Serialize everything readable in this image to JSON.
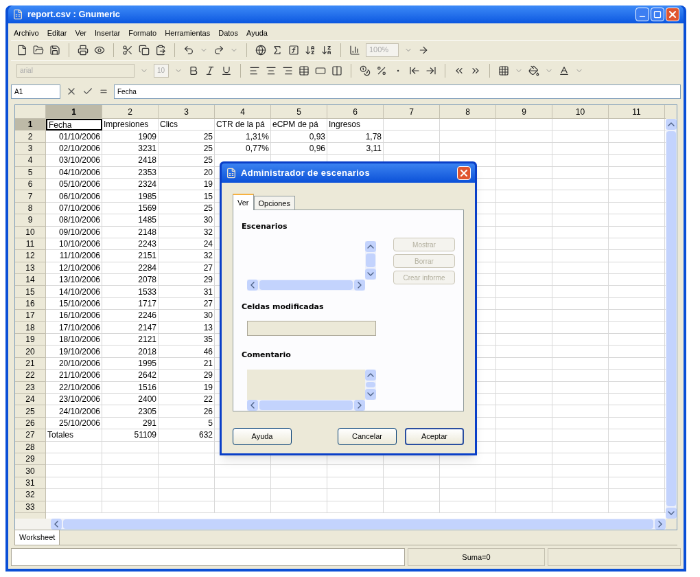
{
  "window": {
    "title": "report.csv : Gnumeric"
  },
  "menu": [
    {
      "label": "Archivo"
    },
    {
      "label": "Editar"
    },
    {
      "label": "Ver"
    },
    {
      "label": "Insertar"
    },
    {
      "label": "Formato"
    },
    {
      "label": "Herramientas"
    },
    {
      "label": "Datos"
    },
    {
      "label": "Ayuda"
    }
  ],
  "toolbar_standard": {
    "zoom": "100%"
  },
  "toolbar_format": {
    "font": "arial",
    "size": "10"
  },
  "formula_bar": {
    "cell": "A1",
    "value": "Fecha"
  },
  "sheet": {
    "columns": [
      {
        "label": "1",
        "selected": true
      },
      {
        "label": "2",
        "selected": false
      },
      {
        "label": "3",
        "selected": false
      },
      {
        "label": "4",
        "selected": false
      },
      {
        "label": "5",
        "selected": false
      },
      {
        "label": "6",
        "selected": false
      },
      {
        "label": "7",
        "selected": false
      },
      {
        "label": "8",
        "selected": false
      },
      {
        "label": "9",
        "selected": false
      },
      {
        "label": "10",
        "selected": false
      },
      {
        "label": "11",
        "selected": false
      }
    ],
    "rows": [
      {
        "label": "1",
        "selected": true,
        "kind": "header",
        "cells": [
          "Fecha",
          "Impresiones",
          "Clics",
          "CTR de la pá",
          "eCPM de pá",
          "Ingresos"
        ]
      },
      {
        "label": "2",
        "selected": false,
        "kind": "data",
        "cells": [
          "01/10/2006",
          "1909",
          "25",
          "1,31%",
          "0,93",
          "1,78"
        ]
      },
      {
        "label": "3",
        "selected": false,
        "kind": "data",
        "cells": [
          "02/10/2006",
          "3231",
          "25",
          "0,77%",
          "0,96",
          "3,11"
        ]
      },
      {
        "label": "4",
        "selected": false,
        "kind": "data",
        "cells": [
          "03/10/2006",
          "2418",
          "25"
        ]
      },
      {
        "label": "5",
        "selected": false,
        "kind": "data",
        "cells": [
          "04/10/2006",
          "2353",
          "20"
        ]
      },
      {
        "label": "6",
        "selected": false,
        "kind": "data",
        "cells": [
          "05/10/2006",
          "2324",
          "19"
        ]
      },
      {
        "label": "7",
        "selected": false,
        "kind": "data",
        "cells": [
          "06/10/2006",
          "1985",
          "15"
        ]
      },
      {
        "label": "8",
        "selected": false,
        "kind": "data",
        "cells": [
          "07/10/2006",
          "1569",
          "25"
        ]
      },
      {
        "label": "9",
        "selected": false,
        "kind": "data",
        "cells": [
          "08/10/2006",
          "1485",
          "30"
        ]
      },
      {
        "label": "10",
        "selected": false,
        "kind": "data",
        "cells": [
          "09/10/2006",
          "2148",
          "32"
        ]
      },
      {
        "label": "11",
        "selected": false,
        "kind": "data",
        "cells": [
          "10/10/2006",
          "2243",
          "24"
        ]
      },
      {
        "label": "12",
        "selected": false,
        "kind": "data",
        "cells": [
          "11/10/2006",
          "2151",
          "32"
        ]
      },
      {
        "label": "13",
        "selected": false,
        "kind": "data",
        "cells": [
          "12/10/2006",
          "2284",
          "27"
        ]
      },
      {
        "label": "14",
        "selected": false,
        "kind": "data",
        "cells": [
          "13/10/2006",
          "2078",
          "29"
        ]
      },
      {
        "label": "15",
        "selected": false,
        "kind": "data",
        "cells": [
          "14/10/2006",
          "1533",
          "31"
        ]
      },
      {
        "label": "16",
        "selected": false,
        "kind": "data",
        "cells": [
          "15/10/2006",
          "1717",
          "27"
        ]
      },
      {
        "label": "17",
        "selected": false,
        "kind": "data",
        "cells": [
          "16/10/2006",
          "2246",
          "30"
        ]
      },
      {
        "label": "18",
        "selected": false,
        "kind": "data",
        "cells": [
          "17/10/2006",
          "2147",
          "13"
        ]
      },
      {
        "label": "19",
        "selected": false,
        "kind": "data",
        "cells": [
          "18/10/2006",
          "2121",
          "35"
        ]
      },
      {
        "label": "20",
        "selected": false,
        "kind": "data",
        "cells": [
          "19/10/2006",
          "2018",
          "46"
        ]
      },
      {
        "label": "21",
        "selected": false,
        "kind": "data",
        "cells": [
          "20/10/2006",
          "1995",
          "21"
        ]
      },
      {
        "label": "22",
        "selected": false,
        "kind": "data",
        "cells": [
          "21/10/2006",
          "2642",
          "29"
        ]
      },
      {
        "label": "23",
        "selected": false,
        "kind": "data",
        "cells": [
          "22/10/2006",
          "1516",
          "19"
        ]
      },
      {
        "label": "24",
        "selected": false,
        "kind": "data",
        "cells": [
          "23/10/2006",
          "2400",
          "22"
        ]
      },
      {
        "label": "25",
        "selected": false,
        "kind": "data",
        "cells": [
          "24/10/2006",
          "2305",
          "26"
        ]
      },
      {
        "label": "26",
        "selected": false,
        "kind": "data",
        "cells": [
          "25/10/2006",
          "291",
          "5"
        ]
      },
      {
        "label": "27",
        "selected": false,
        "kind": "total",
        "cells": [
          "Totales",
          "51109",
          "632"
        ]
      },
      {
        "label": "28",
        "selected": false,
        "kind": "empty"
      },
      {
        "label": "29",
        "selected": false,
        "kind": "empty"
      },
      {
        "label": "30",
        "selected": false,
        "kind": "empty"
      },
      {
        "label": "31",
        "selected": false,
        "kind": "empty"
      },
      {
        "label": "32",
        "selected": false,
        "kind": "empty"
      },
      {
        "label": "33",
        "selected": false,
        "kind": "empty"
      }
    ]
  },
  "sheet_tabs": [
    {
      "label": "Worksheet",
      "selected": true
    }
  ],
  "status_bar": {
    "sum": "Suma=0"
  },
  "dialog": {
    "title": "Administrador de escenarios",
    "tabs": [
      {
        "label": "Ver",
        "selected": true
      },
      {
        "label": "Opciones",
        "selected": false
      }
    ],
    "sections": [
      {
        "kind": "list",
        "label": "Escenarios"
      },
      {
        "kind": "field",
        "label": "Celdas modificadas"
      },
      {
        "kind": "comment",
        "label": "Comentario"
      }
    ],
    "side_buttons": [
      {
        "label": "Mostrar",
        "disabled": true
      },
      {
        "label": "Borrar",
        "disabled": true
      },
      {
        "label": "Crear informe",
        "disabled": true
      }
    ],
    "buttons": [
      {
        "label": "Ayuda",
        "default": false
      },
      {
        "label": "Cancelar",
        "default": false
      },
      {
        "label": "Aceptar",
        "default": true
      }
    ]
  }
}
